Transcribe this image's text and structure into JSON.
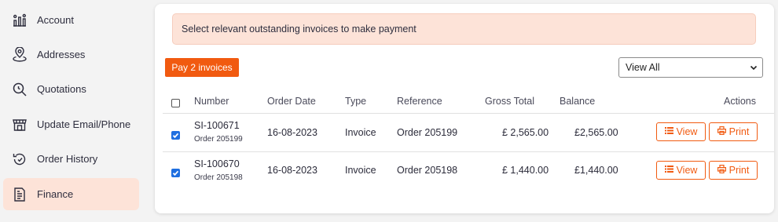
{
  "sidebar": {
    "items": [
      {
        "label": "Account",
        "icon": "account-icon"
      },
      {
        "label": "Addresses",
        "icon": "location-icon"
      },
      {
        "label": "Quotations",
        "icon": "search-icon"
      },
      {
        "label": "Update Email/Phone",
        "icon": "store-icon"
      },
      {
        "label": "Order History",
        "icon": "history-icon"
      },
      {
        "label": "Finance",
        "icon": "document-icon",
        "active": true
      }
    ]
  },
  "notice": "Select relevant outstanding invoices to make payment",
  "pay_button": "Pay 2 invoices",
  "filter": {
    "selected": "View All"
  },
  "table": {
    "headers": {
      "number": "Number",
      "order_date": "Order Date",
      "type": "Type",
      "reference": "Reference",
      "gross_total": "Gross Total",
      "balance": "Balance",
      "actions": "Actions"
    },
    "rows": [
      {
        "number": "SI-100671",
        "order": "Order 205199",
        "date": "16-08-2023",
        "type": "Invoice",
        "reference": "Order 205199",
        "gross": "£ 2,565.00",
        "balance": "£2,565.00",
        "view": "View",
        "print": "Print",
        "checked": true
      },
      {
        "number": "SI-100670",
        "order": "Order 205198",
        "date": "16-08-2023",
        "type": "Invoice",
        "reference": "Order 205198",
        "gross": "£ 1,440.00",
        "balance": "£1,440.00",
        "view": "View",
        "print": "Print",
        "checked": true
      }
    ]
  },
  "colors": {
    "accent": "#f15a10",
    "accent_light": "#fde3d8",
    "checkbox": "#1f6fe0"
  }
}
